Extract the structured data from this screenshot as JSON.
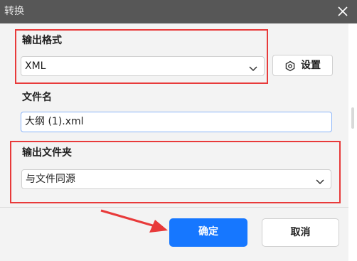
{
  "dialog": {
    "title": "转换",
    "close_icon": "close-icon"
  },
  "output_format": {
    "label": "输出格式",
    "value": "XML",
    "settings_label": "设置",
    "settings_icon": "gear-icon"
  },
  "file_name": {
    "label": "文件名",
    "value": "大纲 (1).xml"
  },
  "output_folder": {
    "label": "输出文件夹",
    "value": "与文件同源"
  },
  "footer": {
    "confirm_label": "确定",
    "cancel_label": "取消"
  },
  "colors": {
    "highlight": "#e83a3a",
    "primary": "#1677ff",
    "titlebar": "#575757"
  }
}
